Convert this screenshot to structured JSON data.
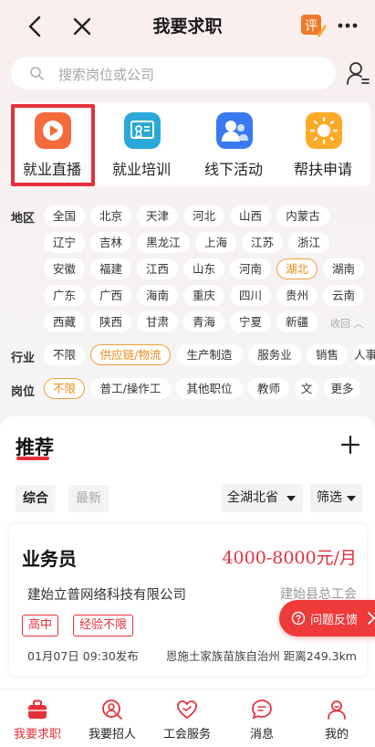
{
  "header": {
    "title": "我要求职",
    "back_icon": "back-arrow-icon",
    "close_icon": "close-icon",
    "eval_badge": "评",
    "more_icon": "more-icon"
  },
  "search": {
    "placeholder": "搜索岗位或公司"
  },
  "categories": [
    {
      "label": "就业直播",
      "icon": "live-play-icon",
      "color": "#f56a3a"
    },
    {
      "label": "就业培训",
      "icon": "training-certificate-icon",
      "color": "#2aa9d8"
    },
    {
      "label": "线下活动",
      "icon": "people-activity-icon",
      "color": "#3a7af0"
    },
    {
      "label": "帮扶申请",
      "icon": "sun-help-icon",
      "color": "#ffa928"
    }
  ],
  "filters": {
    "region_label": "地区",
    "regions": [
      "全国",
      "北京",
      "天津",
      "河北",
      "山西",
      "内蒙古",
      "辽宁",
      "吉林",
      "黑龙江",
      "上海",
      "江苏",
      "浙江",
      "安徽",
      "福建",
      "江西",
      "山东",
      "河南",
      "湖北",
      "湖南",
      "广东",
      "广西",
      "海南",
      "重庆",
      "四川",
      "贵州",
      "云南",
      "西藏",
      "陕西",
      "甘肃",
      "青海",
      "宁夏",
      "新疆"
    ],
    "region_selected": "湖北",
    "collapse_label": "收回",
    "industry_label": "行业",
    "industries": [
      "不限",
      "供应链/物流",
      "生产制造",
      "服务业",
      "销售",
      "人事"
    ],
    "industry_selected": "供应链/物流",
    "position_label": "岗位",
    "positions": [
      "不限",
      "普工/操作工",
      "其他职位",
      "教师",
      "文",
      "更多"
    ],
    "position_selected": "不限"
  },
  "recommend": {
    "title": "推荐",
    "tabs": [
      "综合",
      "最新"
    ],
    "active_tab": "综合",
    "region_select": "全湖北省",
    "filter_select": "筛选"
  },
  "job_card": {
    "title": "业务员",
    "salary": "4000-8000元/月",
    "company": "建始立普网络科技有限公司",
    "union": "建始县总工会",
    "tags": [
      "高中",
      "经验不限"
    ],
    "posted": "01月07日 09:30发布",
    "location": "恩施土家族苗族自治州 距离249.3km"
  },
  "feedback": {
    "label": "问题反馈"
  },
  "tabbar": [
    {
      "label": "我要求职",
      "icon": "briefcase-icon",
      "active": true
    },
    {
      "label": "我要招人",
      "icon": "recruit-search-icon",
      "active": false
    },
    {
      "label": "工会服务",
      "icon": "heart-service-icon",
      "active": false
    },
    {
      "label": "消息",
      "icon": "message-icon",
      "active": false
    },
    {
      "label": "我的",
      "icon": "profile-icon",
      "active": false
    }
  ],
  "colors": {
    "primary": "#e5303b",
    "accent_orange": "#ee8a1c"
  }
}
